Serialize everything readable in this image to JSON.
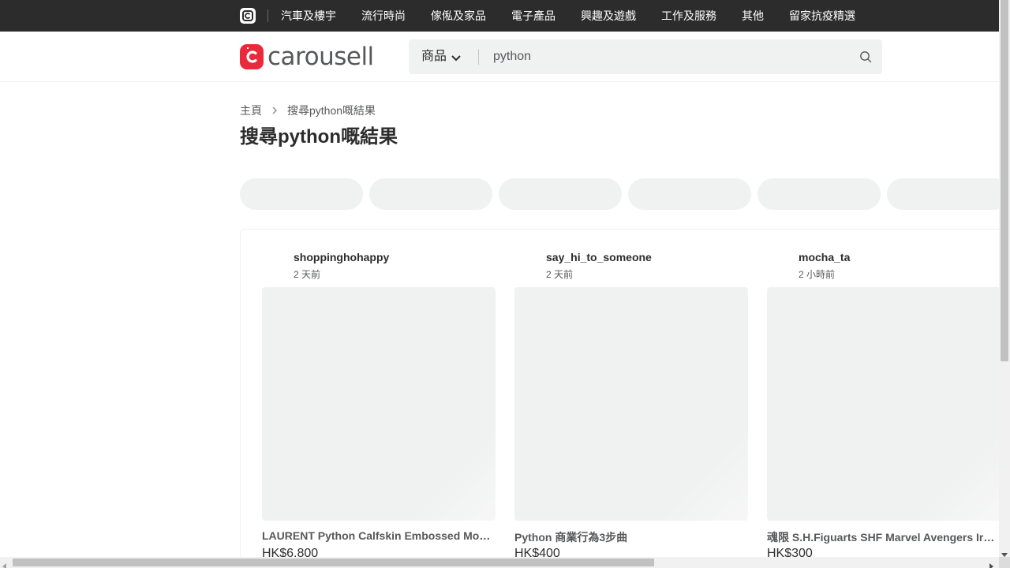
{
  "topbar": {
    "categories": [
      "汽車及樓宇",
      "流行時尚",
      "傢俬及家品",
      "電子產品",
      "興趣及遊戲",
      "工作及服務",
      "其他",
      "留家抗疫精選"
    ]
  },
  "header": {
    "logo_text": "carousell",
    "search": {
      "scope": "商品",
      "query": "python"
    }
  },
  "breadcrumb": {
    "home": "主頁",
    "current": "搜尋python嘅結果"
  },
  "page_title": "搜尋python嘅結果",
  "listings": [
    {
      "seller": "shoppinghohappy",
      "time": "2 天前",
      "name": "LAURENT Python Calfskin Embossed Mo…",
      "price": "HK$6,800"
    },
    {
      "seller": "say_hi_to_someone",
      "time": "2 天前",
      "name": "Python 商業行為3步曲",
      "price": "HK$400"
    },
    {
      "seller": "mocha_ta",
      "time": "2 小時前",
      "name": "魂限 S.H.Figuarts SHF Marvel Avengers Ir…",
      "price": "HK$300"
    }
  ],
  "colors": {
    "brand": "#ea2a3c",
    "topbar": "#2c2c2d",
    "placeholder": "#f0f1f1"
  },
  "icons": [
    "carousell-mini-logo",
    "carousell-logo-mark",
    "chevron-down-icon",
    "search-icon",
    "chevron-right-icon",
    "scroll-arrow"
  ]
}
